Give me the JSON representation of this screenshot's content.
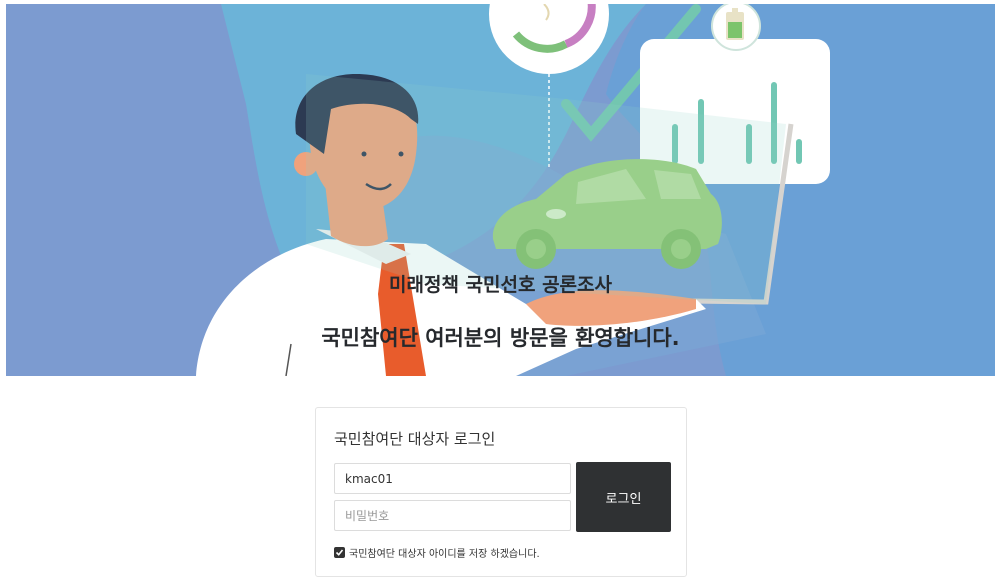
{
  "hero": {
    "title": "미래정책 국민선호 공론조사",
    "subtitle": "국민참여단 여러분의 방문을 환영합니다."
  },
  "login": {
    "title": "국민참여단 대상자 로그인",
    "id_value": "kmac01",
    "password_placeholder": "비밀번호",
    "button_label": "로그인",
    "save_id_label": "국민참여단 대상자 아이디를 저장 하겠습니다.",
    "save_id_checked": true
  },
  "colors": {
    "hero_bg": "#7c9bd0",
    "button": "#2f3133"
  },
  "icons": [
    "checkmark-icon",
    "battery-icon",
    "car-illustration",
    "bar-chart-illustration",
    "businessman-illustration",
    "check-icon"
  ]
}
